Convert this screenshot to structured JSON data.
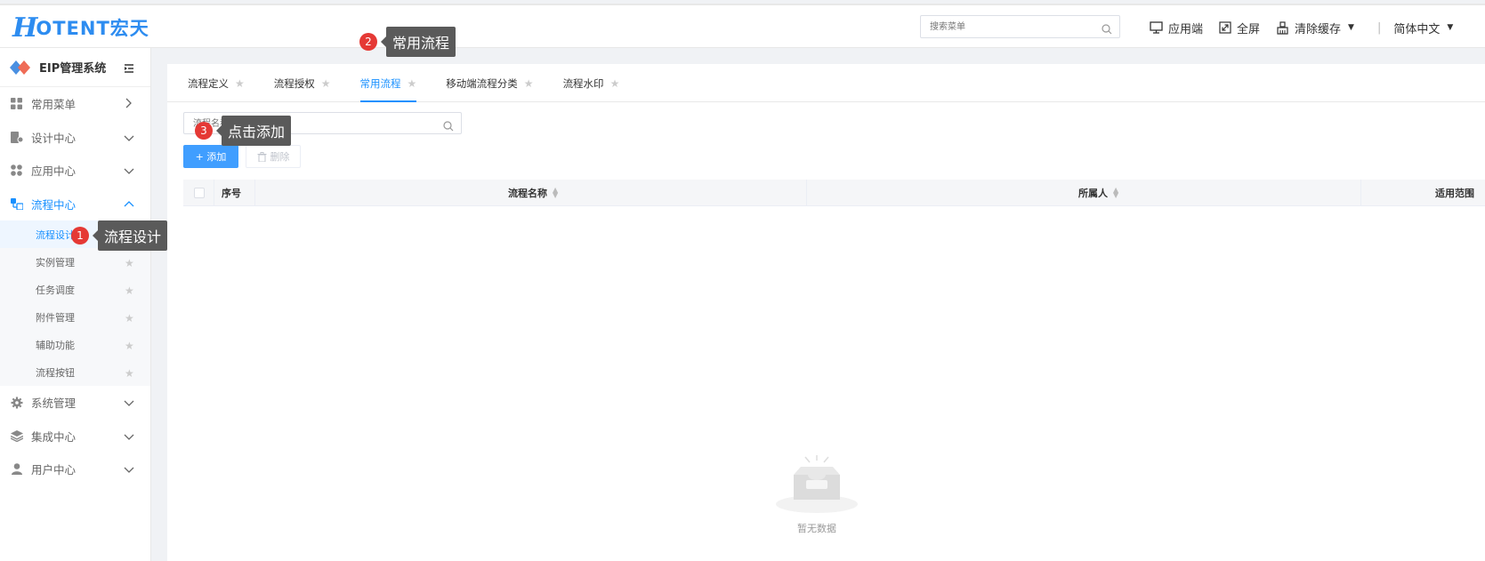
{
  "header": {
    "logo_h": "H",
    "logo_rest": "OTENT宏天",
    "search_placeholder": "搜索菜单",
    "actions": [
      {
        "label": "应用端"
      },
      {
        "label": "全屏"
      },
      {
        "label": "清除缓存"
      }
    ],
    "separator": "|",
    "language": "简体中文"
  },
  "sidebar": {
    "system_title": "EIP管理系统",
    "menu": [
      {
        "label": "常用菜单"
      },
      {
        "label": "设计中心"
      },
      {
        "label": "应用中心"
      },
      {
        "label": "流程中心"
      },
      {
        "label": "系统管理"
      },
      {
        "label": "集成中心"
      },
      {
        "label": "用户中心"
      }
    ],
    "submenu": [
      {
        "label": "流程设计"
      },
      {
        "label": "实例管理"
      },
      {
        "label": "任务调度"
      },
      {
        "label": "附件管理"
      },
      {
        "label": "辅助功能"
      },
      {
        "label": "流程按钮"
      }
    ]
  },
  "tabs": [
    {
      "label": "流程定义"
    },
    {
      "label": "流程授权"
    },
    {
      "label": "常用流程"
    },
    {
      "label": "移动端流程分类"
    },
    {
      "label": "流程水印"
    }
  ],
  "toolbar": {
    "query_placeholder": "流程名称",
    "add_label": "+ 添加",
    "delete_label": "删除"
  },
  "table": {
    "columns": [
      "序号",
      "流程名称",
      "所属人",
      "适用范围"
    ],
    "empty_text": "暂无数据"
  },
  "annotations": [
    {
      "number": "1",
      "text": "流程设计"
    },
    {
      "number": "2",
      "text": "常用流程"
    },
    {
      "number": "3",
      "text": "点击添加"
    }
  ],
  "colors": {
    "primary": "#1890ff",
    "button": "#409eff",
    "badge": "#e53935",
    "tooltip": "#5a5a5a"
  }
}
